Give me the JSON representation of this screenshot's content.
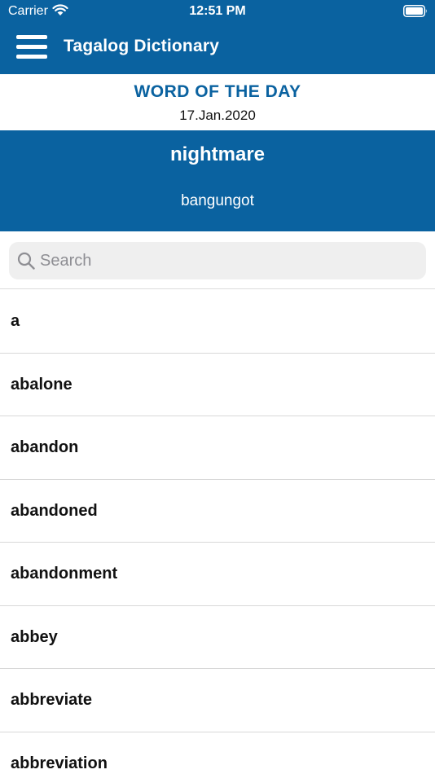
{
  "status_bar": {
    "carrier": "Carrier",
    "time": "12:51 PM",
    "icons": [
      "wifi-icon",
      "battery-icon"
    ]
  },
  "nav": {
    "menu_icon": "hamburger-menu-icon",
    "title": "Tagalog Dictionary"
  },
  "word_of_the_day": {
    "heading": "WORD OF THE DAY",
    "date": "17.Jan.2020",
    "word": "nightmare",
    "translation": "bangungot"
  },
  "search": {
    "placeholder": "Search",
    "value": "",
    "icon": "search-icon"
  },
  "words": [
    "a",
    "abalone",
    "abandon",
    "abandoned",
    "abandonment",
    "abbey",
    "abbreviate",
    "abbreviation"
  ],
  "colors": {
    "brand_blue": "#0a62a0",
    "white": "#ffffff",
    "search_bg": "#efefef",
    "placeholder": "#8e8e93"
  }
}
